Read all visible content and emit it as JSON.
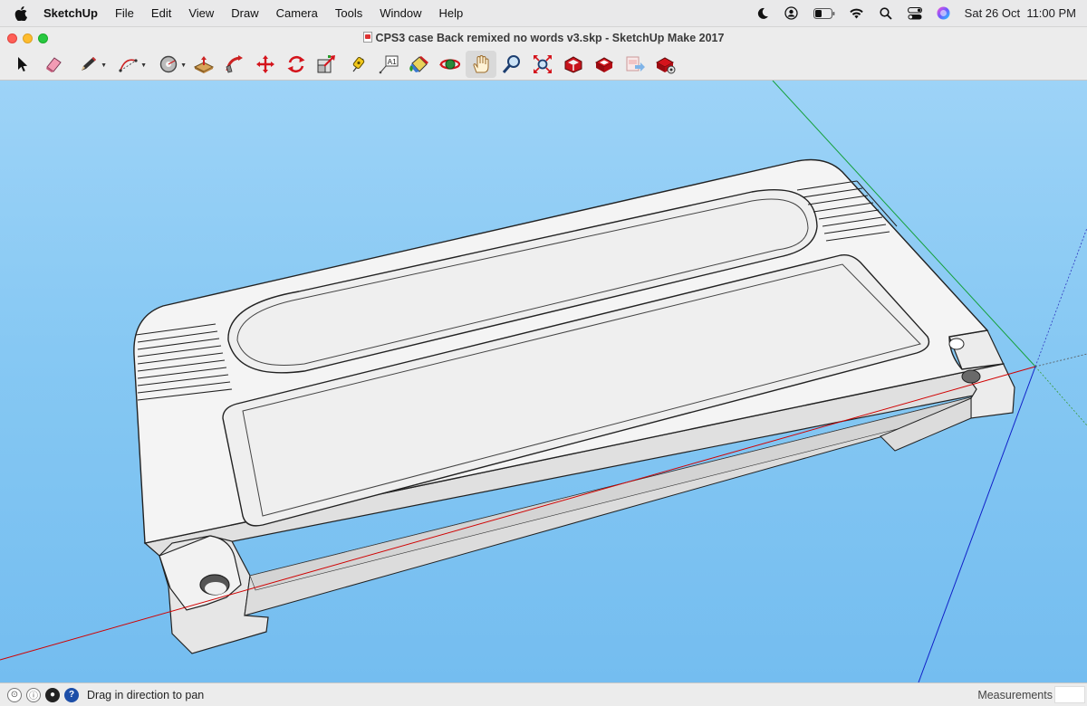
{
  "menubar": {
    "app_name": "SketchUp",
    "items": [
      "File",
      "Edit",
      "View",
      "Draw",
      "Camera",
      "Tools",
      "Window",
      "Help"
    ],
    "clock": "Sat 26 Oct  11:00 PM"
  },
  "window": {
    "title": "CPS3 case Back remixed no words v3.skp - SketchUp Make 2017"
  },
  "toolbar": {
    "tools": [
      "select",
      "eraser",
      "pencil",
      "arc",
      "shapes",
      "push-pull",
      "follow-me",
      "move",
      "rotate",
      "scale",
      "tape-measure",
      "text",
      "paint-bucket",
      "orbit",
      "pan",
      "zoom",
      "zoom-extents",
      "warehouse",
      "extension-warehouse",
      "send-to-layout",
      "extension-manager"
    ],
    "active_tool": "pan"
  },
  "status": {
    "hint": "Drag in direction to pan",
    "measurements_label": "Measurements",
    "measurements_value": ""
  },
  "colors": {
    "sky_top": "#9dd3f7",
    "sky_bottom": "#74bdf0",
    "model_face": "#f4f4f4",
    "axis_red": "#d00000",
    "axis_green": "#00a000",
    "axis_blue": "#0000c8"
  }
}
